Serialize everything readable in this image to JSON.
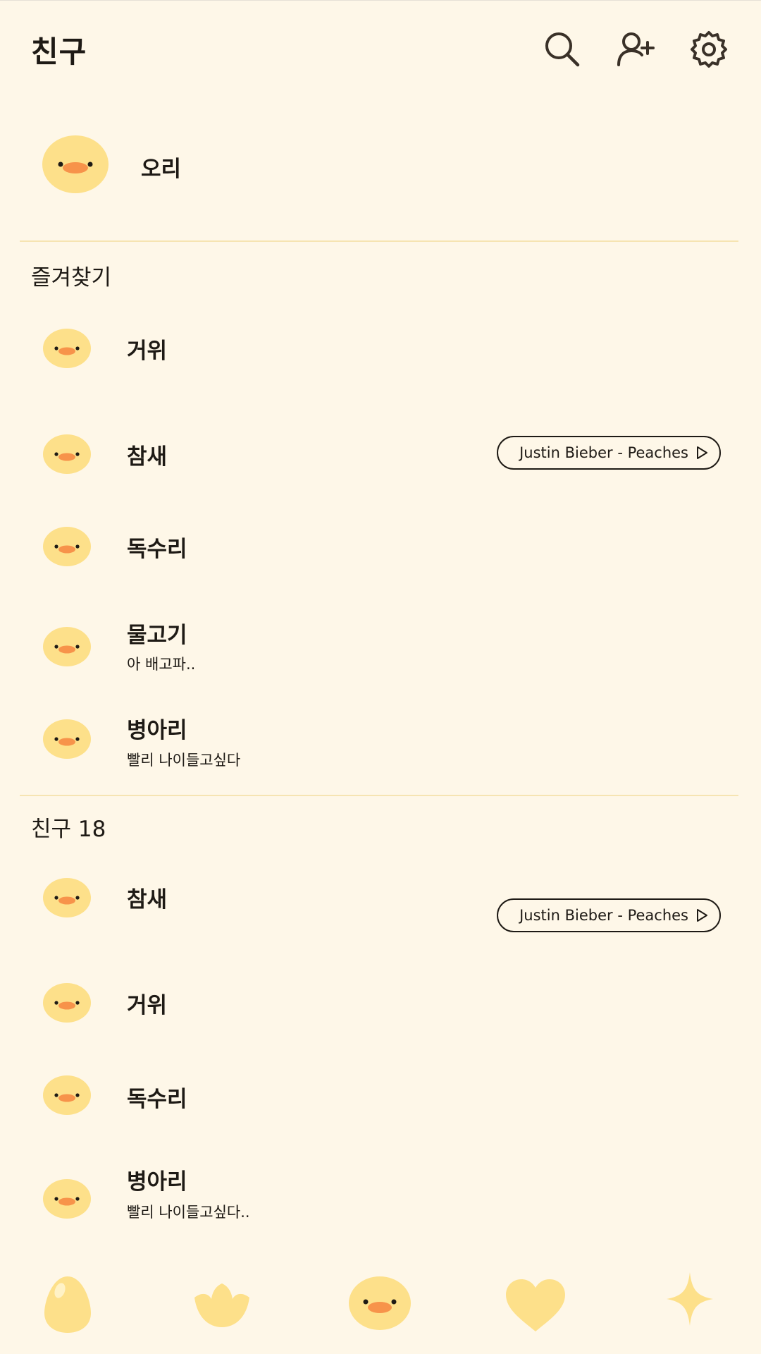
{
  "header": {
    "title": "친구"
  },
  "profile": {
    "name": "오리"
  },
  "favorites": {
    "label": "즐겨찾기",
    "items": [
      {
        "name": "거위"
      },
      {
        "name": "참새",
        "music": "Justin Bieber - Peaches"
      },
      {
        "name": "독수리"
      },
      {
        "name": "물고기",
        "status": "아 배고파.."
      },
      {
        "name": "병아리",
        "status": "빨리 나이들고싶다"
      }
    ]
  },
  "friends": {
    "label": "친구 18",
    "items": [
      {
        "name": "참새",
        "music": "Justin Bieber - Peaches"
      },
      {
        "name": "거위"
      },
      {
        "name": "독수리"
      },
      {
        "name": "병아리",
        "status": "빨리 나이들고싶다.."
      }
    ]
  },
  "colors": {
    "background": "#fef7e8",
    "duck_yellow": "#fde08a",
    "beak_orange": "#f7934a",
    "divider": "#f6e4b2",
    "text": "#1e1a15"
  },
  "icons": {
    "header": [
      "search-icon",
      "add-friend-icon",
      "settings-icon"
    ],
    "nav": [
      "egg-icon",
      "tulip-icon",
      "duck-icon",
      "heart-icon",
      "sparkle-icon"
    ]
  }
}
